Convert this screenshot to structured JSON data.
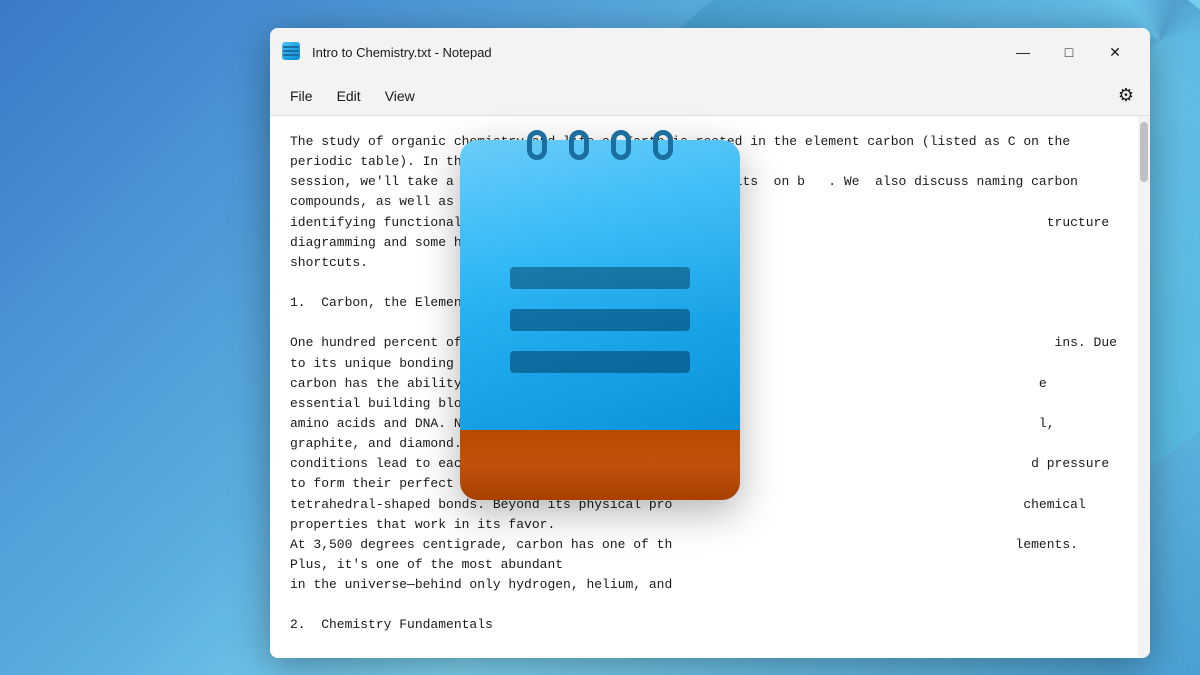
{
  "desktop": {
    "background_color": "#4a9fd4"
  },
  "window": {
    "title": "Intro to Chemistry.txt - Notepad",
    "icon": "notepad-icon"
  },
  "titlebar": {
    "minimize_label": "—",
    "maximize_label": "□",
    "close_label": "✕"
  },
  "menubar": {
    "items": [
      {
        "label": "File",
        "id": "file"
      },
      {
        "label": "Edit",
        "id": "edit"
      },
      {
        "label": "View",
        "id": "view"
      }
    ],
    "settings_icon": "⚙"
  },
  "content": {
    "text": "The study of organic chemistry and life on Earth is rooted in the element carbon (listed as C on the periodic table). In this\nsession, we'll take a look at carbon, its properties,    its  on b   . We  also discuss naming carbon compounds, as well as\nidentifying functional organic compound groups. Fi                                               tructure diagramming and some handy\nshortcuts.\n\n1.  Carbon, the Element\n\nOne hundred percent of known life on Earth is made                                                ins. Due to its unique bonding properties,\ncarbon has the ability to form long chains of mol                                               e essential building blocks of life, namely\namino acids and DNA. Naturally occurring pure carb                                              l, graphite, and diamond. Different\nconditions lead to each form. For instance, diamo                                              d pressure to form their perfect\ntetrahedral-shaped bonds. Beyond its physical pro                                             chemical properties that work in its favor.\nAt 3,500 degrees centigrade, carbon has one of th                                            lements. Plus, it's one of the most abundant\nin the universe—behind only hydrogen, helium, and\n\n2.  Chemistry Fundamentals\n\nWorking with organic chemistry requires significan                                           before getting started. Here we provide a\nbrief review of valence shell theory, Lewis struc                                            f what we know about chemical bonding\nrevolves around valence shell theory—the idea tha                                           rons to achieve full outer shells. Carbon is\nunique in this respect due to the four electrons i                                          n or lose four electrons while bonding,\nallowing it to achieve up to four atomic bonds wi                                          ibe organic molecules' bonds, we need to\nunderstand the methods for transcribing them. Lew                                          in describing the paired and unpaired\nelectrons in valence shells. Using Lewis dot structures (and examining resonant structures) can help explain the shapes and\nbonding possibilities within organic compounds. Understanding the electron orbital shells can help illuminate the eventual shapes\nand resulting bonds in organic compounds. Just knowing the chemical elements that comprise a molecule can tell us its basic shape,\nthe angle of its bonds, and its underlying properties.\n\n3.  Carbon Bonds in Organic Compounds\n\nAgain, carbon can form up to four bonds with other molecules. In organic chemistry, we mainly focus on carbon chains with hydrogen\nand oxygen, but there are infinite possible compounds. In the simplest form, carbon bonds with four hydrogen in single bonds. In"
  }
}
